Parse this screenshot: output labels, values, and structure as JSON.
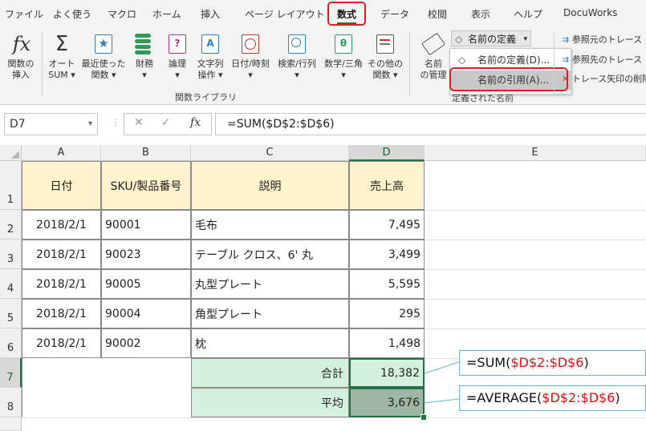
{
  "tabs": [
    "ファイル",
    "よく使う",
    "マクロ",
    "ホーム",
    "挿入",
    "ページ レイアウト",
    "数式",
    "データ",
    "校閲",
    "表示",
    "ヘルプ",
    "DocuWorks"
  ],
  "ribbon": {
    "insert_function": [
      "関数の",
      "挿入"
    ],
    "autosum": [
      "オート",
      "SUM"
    ],
    "recent": [
      "最近使った",
      "関数"
    ],
    "financial": "財務",
    "logical": "論理",
    "text": [
      "文字列",
      "操作"
    ],
    "datetime": "日付/時刻",
    "lookup": "検索/行列",
    "math": "数学/三角",
    "more": [
      "その他の",
      "関数"
    ],
    "function_library_label": "関数ライブラリ",
    "name_manager": [
      "名前",
      "の管理"
    ],
    "define_name": "名前の定義",
    "defined_names_label": "定義された名前",
    "dropdown_define": "名前の定義(D)...",
    "dropdown_paste": "名前の引用(A)...",
    "trace_precedents": "参照元のトレース",
    "trace_dependents": "参照先のトレース",
    "remove_arrows": "トレース矢印の削除"
  },
  "formula_bar": {
    "name_box": "D7",
    "cancel": "✕",
    "enter": "✓",
    "fx": "fx",
    "formula": "=SUM($D$2:$D$6)"
  },
  "grid": {
    "columns": [
      "A",
      "B",
      "C",
      "D",
      "E"
    ],
    "rows": [
      "1",
      "2",
      "3",
      "4",
      "5",
      "6",
      "7",
      "8"
    ],
    "headers": [
      "日付",
      "SKU/製品番号",
      "説明",
      "売上高"
    ],
    "data": [
      [
        "2018/2/1",
        "90001",
        "毛布",
        "7,495"
      ],
      [
        "2018/2/1",
        "90023",
        "テーブル クロス、6' 丸",
        "3,499"
      ],
      [
        "2018/2/1",
        "90005",
        "丸型プレート",
        "5,595"
      ],
      [
        "2018/2/1",
        "90004",
        "角型プレート",
        "295"
      ],
      [
        "2018/2/1",
        "90002",
        "枕",
        "1,498"
      ]
    ],
    "total_label": "合計",
    "total_value": "18,382",
    "avg_label": "平均",
    "avg_value": "3,676"
  },
  "callouts": {
    "sum_prefix": "=SUM(",
    "sum_range": "$D$2:$D$6",
    "sum_suffix": ")",
    "avg_prefix": "=AVERAGE(",
    "avg_range": "$D$2:$D$6",
    "avg_suffix": ")"
  },
  "colors": {
    "accent": "#217346",
    "highlight": "#e02020",
    "header_fill": "#fff2cc",
    "total_fill": "#d4f1e0"
  }
}
